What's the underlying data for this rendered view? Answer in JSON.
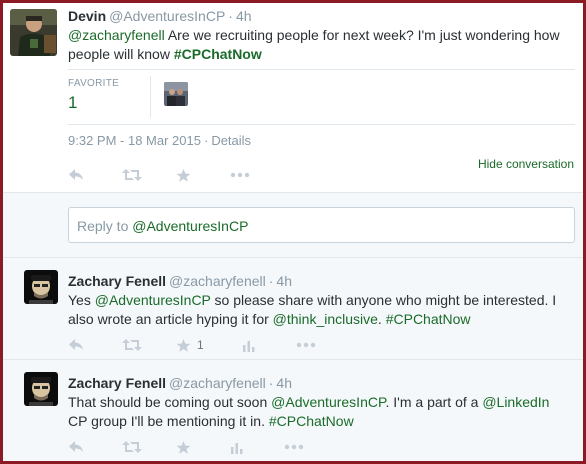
{
  "main_tweet": {
    "name": "Devin",
    "handle": "@AdventuresInCP",
    "sep": "·",
    "time": "4h",
    "text": {
      "mention": "@zacharyfenell",
      "body": " Are we recruiting people for next week? I'm just wondering how people will know ",
      "hashtag": "#CPChatNow"
    },
    "stats": {
      "label": "FAVORITE",
      "count": "1"
    },
    "timestamp": "9:32 PM - 18 Mar 2015",
    "details_sep": "·",
    "details": "Details",
    "hide_conversation": "Hide conversation"
  },
  "reply_box": {
    "prefix": "Reply to ",
    "mention": "@AdventuresInCP"
  },
  "replies": [
    {
      "name": "Zachary Fenell",
      "handle": "@zacharyfenell",
      "sep": "·",
      "time": "4h",
      "parts": [
        "Yes ",
        "@AdventuresInCP",
        " so please share with anyone who might be interested. I also wrote an article hyping it for ",
        "@think_inclusive",
        ". ",
        "#CPChatNow"
      ],
      "favorite_count": "1"
    },
    {
      "name": "Zachary Fenell",
      "handle": "@zacharyfenell",
      "sep": "·",
      "time": "4h",
      "parts": [
        "That should be coming out soon ",
        "@AdventuresInCP",
        ". I'm a part of a ",
        "@LinkedIn",
        " CP group I'll be mentioning it in. ",
        "#CPChatNow"
      ],
      "favorite_count": ""
    }
  ],
  "icons": {
    "reply": "reply-icon",
    "retweet": "retweet-icon",
    "favorite": "star-icon",
    "analytics": "analytics-icon",
    "more": "more-icon"
  },
  "colors": {
    "link": "#1a6b2a",
    "action_icon": "#c5ced6",
    "border": "#8b1a24",
    "reply_bg": "#f5f8fa"
  }
}
